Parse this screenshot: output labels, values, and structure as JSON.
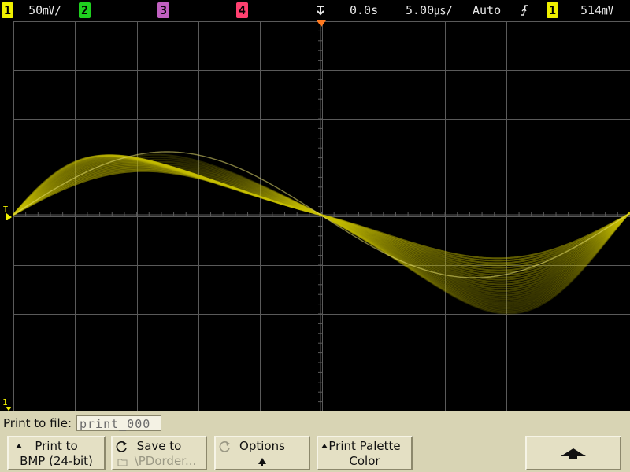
{
  "top_bar": {
    "ch1": {
      "badge": "1",
      "scale": "50㎷/",
      "color": "#f0f000"
    },
    "ch2": {
      "badge": "2",
      "color": "#1fd01f"
    },
    "ch3": {
      "badge": "3",
      "color": "#c060c0"
    },
    "ch4": {
      "badge": "4",
      "color": "#ff4070"
    },
    "delay": "0.0s",
    "timebase": "5.00㎲/",
    "trigger_mode": "Auto",
    "trigger_slope_icon": "rising-edge-icon",
    "trigger_source_badge": "1",
    "trigger_level": "514㎷"
  },
  "screen": {
    "trace_color": "#c8c000",
    "grid_color": "#5a5a5a",
    "trigger_marker_label": "T",
    "ground_marker_label": "1",
    "trace": {
      "description_free": true,
      "cycles_shown": 2,
      "inner_amplitude_div": 1.0,
      "outer_amplitude_div": 2.1
    }
  },
  "print_to_file": {
    "label": "Print to file:",
    "filename": "print_000"
  },
  "softkeys": {
    "print": {
      "line1": "Print to",
      "line2": "BMP (24-bit)"
    },
    "save": {
      "line1": "Save to",
      "line2": "\\PDorder..."
    },
    "options": {
      "line1": "Options"
    },
    "palette": {
      "line1": "Print Palette",
      "line2": "Color"
    }
  }
}
